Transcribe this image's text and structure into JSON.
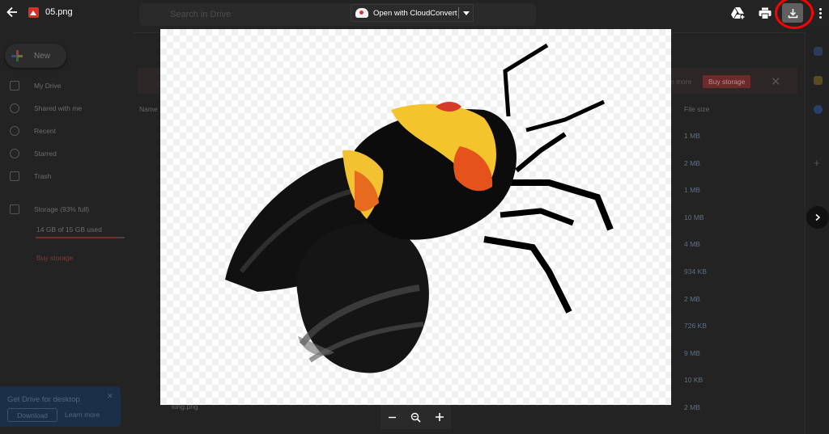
{
  "viewer": {
    "file_name": "05.png",
    "open_with_label": "Open with CloudConvert",
    "icons": {
      "back": "arrow-left-icon",
      "add_to_drive": "add-to-drive-icon",
      "print": "print-icon",
      "download": "download-icon",
      "more": "more-vert-icon",
      "next": "chevron-right-icon",
      "zoom_out": "minus-icon",
      "zoom_reset": "zoom-icon",
      "zoom_in": "plus-icon"
    },
    "highlight_color": "#ff0000"
  },
  "drive_background": {
    "search_placeholder": "Search in Drive",
    "new_label": "New",
    "nav": [
      "My Drive",
      "Shared with me",
      "Recent",
      "Starred",
      "Trash"
    ],
    "storage_label": "Storage (93% full)",
    "storage_used": "14 GB of 15 GB used",
    "storage_fraction": 0.93,
    "buy_storage": "Buy storage",
    "alert_more": "n more",
    "alert_buy": "Buy storage",
    "col_name": "Name",
    "col_size": "File size",
    "sizes": [
      "1 MB",
      "2 MB",
      "1 MB",
      "10 MB",
      "4 MB",
      "934 KB",
      "2 MB",
      "726 KB",
      "9 MB",
      "10 KB",
      "2 MB"
    ],
    "file_name_partial": "lung.png",
    "get_drive": "Get Drive for desktop",
    "download": "Download",
    "learn_more": "Learn more"
  }
}
